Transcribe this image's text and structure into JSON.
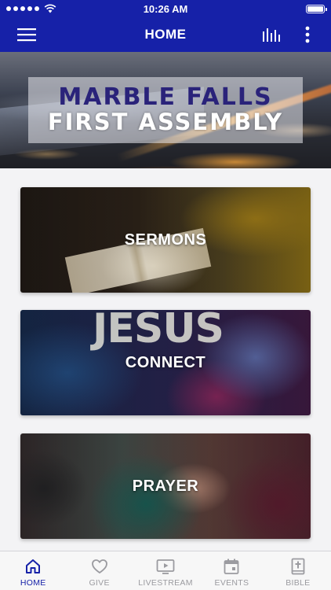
{
  "status_bar": {
    "time": "10:26 AM",
    "signal_dots": 5,
    "battery_level": 1.0
  },
  "app_bar": {
    "title": "HOME",
    "menu_icon": "hamburger-menu-icon",
    "audio_icon": "audio-bars-icon",
    "more_icon": "vertical-dots-icon",
    "background_color": "#1621a8"
  },
  "hero": {
    "line1": "MARBLE FALLS",
    "line2": "FIRST ASSEMBLY"
  },
  "cards": [
    {
      "label": "SERMONS"
    },
    {
      "label": "CONNECT",
      "background_text": "JESUS"
    },
    {
      "label": "PRAYER"
    }
  ],
  "tab_bar": {
    "active_color": "#1621a8",
    "inactive_color": "#9b9ba0",
    "items": [
      {
        "label": "HOME",
        "icon": "home-icon",
        "active": true
      },
      {
        "label": "GIVE",
        "icon": "heart-icon",
        "active": false
      },
      {
        "label": "LIVESTREAM",
        "icon": "video-play-icon",
        "active": false
      },
      {
        "label": "EVENTS",
        "icon": "calendar-icon",
        "active": false
      },
      {
        "label": "BIBLE",
        "icon": "bible-cross-icon",
        "active": false
      }
    ]
  }
}
